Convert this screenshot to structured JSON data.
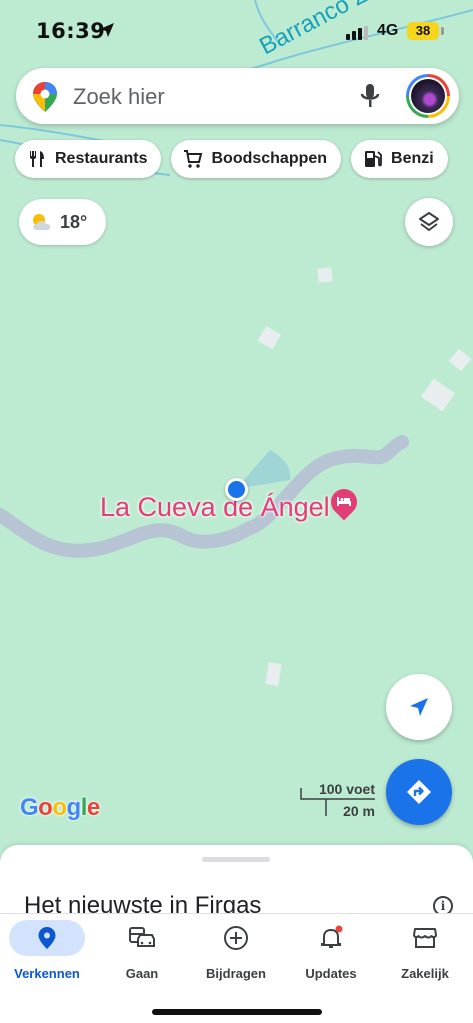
{
  "status_bar": {
    "time": "16:39",
    "network": "4G",
    "battery": "38"
  },
  "search": {
    "placeholder": "Zoek hier"
  },
  "chips": [
    {
      "label": "Restaurants",
      "icon": "fork-knife-icon"
    },
    {
      "label": "Boodschappen",
      "icon": "cart-icon"
    },
    {
      "label": "Benzi",
      "icon": "fuel-icon"
    }
  ],
  "weather": {
    "temperature": "18°",
    "icon": "partly-cloudy-icon"
  },
  "map": {
    "river_label": "Barranco Zuaje",
    "place_name": "La Cueva de Ángel",
    "place_color": "#e23d74",
    "scale_top": "100 voet",
    "scale_bottom": "20 m",
    "attribution": "Google"
  },
  "sheet": {
    "title": "Het nieuwste in Firgas"
  },
  "tabs": [
    {
      "label": "Verkennen",
      "icon": "location-pin-icon",
      "active": true
    },
    {
      "label": "Gaan",
      "icon": "commute-icon"
    },
    {
      "label": "Bijdragen",
      "icon": "add-circle-icon"
    },
    {
      "label": "Updates",
      "icon": "bell-icon"
    },
    {
      "label": "Zakelijk",
      "icon": "storefront-icon"
    }
  ],
  "colors": {
    "accent": "#1a73e8",
    "map_bg": "#bdebd2",
    "river": "#7ec8dc",
    "road": "#b7c4d3"
  }
}
